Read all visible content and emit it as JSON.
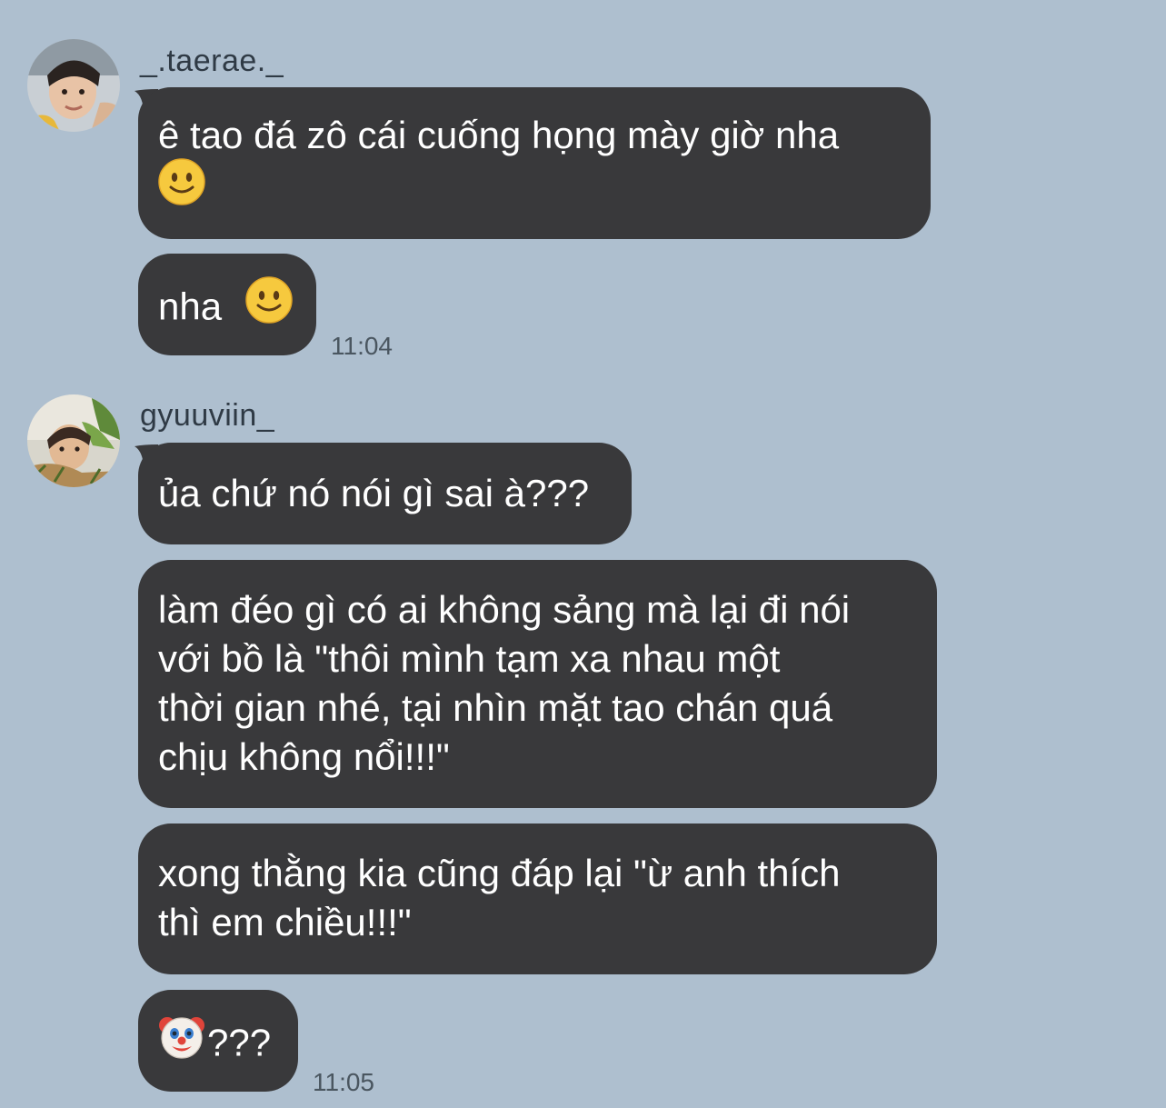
{
  "chat": {
    "groups": [
      {
        "username": "_.taerae._",
        "messages": [
          {
            "lines": [
              "ê tao đá zô cái cuống họng mày giờ nha"
            ],
            "trailing_emoji": "slightly-smiling-face"
          },
          {
            "text": "nha",
            "trailing_emoji": "slightly-smiling-face"
          }
        ],
        "time": "11:04"
      },
      {
        "username": "gyuuviin_",
        "messages": [
          {
            "text": "ủa chứ nó nói gì sai à???"
          },
          {
            "lines": [
              "làm đéo gì có ai không sảng mà lại đi nói",
              "với bồ là \"thôi mình tạm xa nhau một",
              "thời gian nhé, tại nhìn mặt tao chán quá",
              "chịu không nổi!!!\""
            ]
          },
          {
            "lines": [
              "xong thằng kia cũng đáp lại \"ừ anh thích",
              "thì em chiều!!!\""
            ]
          },
          {
            "leading_emoji": "clown-face",
            "text": "???"
          }
        ],
        "time": "11:05"
      }
    ]
  },
  "colors": {
    "background": "#aebfcf",
    "bubble": "#39393b",
    "bubble_text": "#ffffff",
    "meta_text": "#4a5660"
  }
}
